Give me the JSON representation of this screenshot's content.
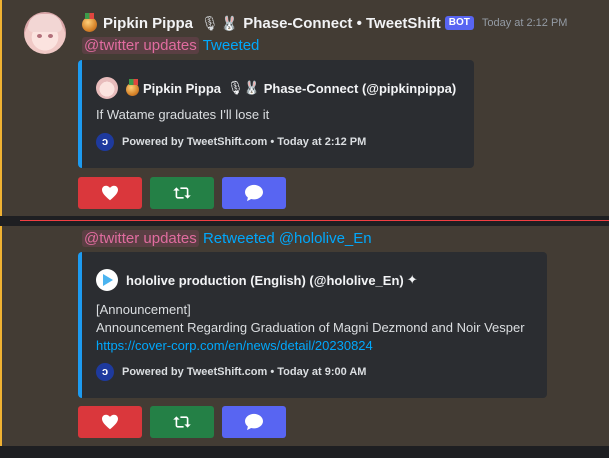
{
  "colors": {
    "accent_border": "#f0b232",
    "embed_border": "#1d9bf0",
    "like": "#da373c",
    "retweet": "#248046",
    "reply": "#5865f2",
    "link": "#00a8fc"
  },
  "message1": {
    "author": "Pipkin Pippa",
    "app_name": "Phase-Connect • TweetShift",
    "bot_tag": "BOT",
    "timestamp": "Today at 2:12 PM",
    "mention": "@twitter updates",
    "action": "Tweeted",
    "embed": {
      "author_line": "Pipkin Pippa",
      "author_handle": "Phase-Connect (@pipkinpippa)",
      "text": "If Watame graduates I'll lose it",
      "footer": "Powered by TweetShift.com • Today at 2:12 PM"
    },
    "buttons": [
      {
        "icon": "heart-icon"
      },
      {
        "icon": "retweet-icon"
      },
      {
        "icon": "reply-bubble-icon"
      }
    ]
  },
  "message2": {
    "mention": "@twitter updates",
    "action": "Retweeted @hololive_En",
    "embed": {
      "author_line": "hololive production (English) (@hololive_En)",
      "text_line1": "[Announcement]",
      "text_line2": "Announcement Regarding Graduation of Magni Dezmond and Noir Vesper",
      "link": "https://cover-corp.com/en/news/detail/20230824",
      "footer": "Powered by TweetShift.com • Today at 9:00 AM"
    },
    "buttons": [
      {
        "icon": "heart-icon"
      },
      {
        "icon": "retweet-icon"
      },
      {
        "icon": "reply-bubble-icon"
      }
    ]
  }
}
